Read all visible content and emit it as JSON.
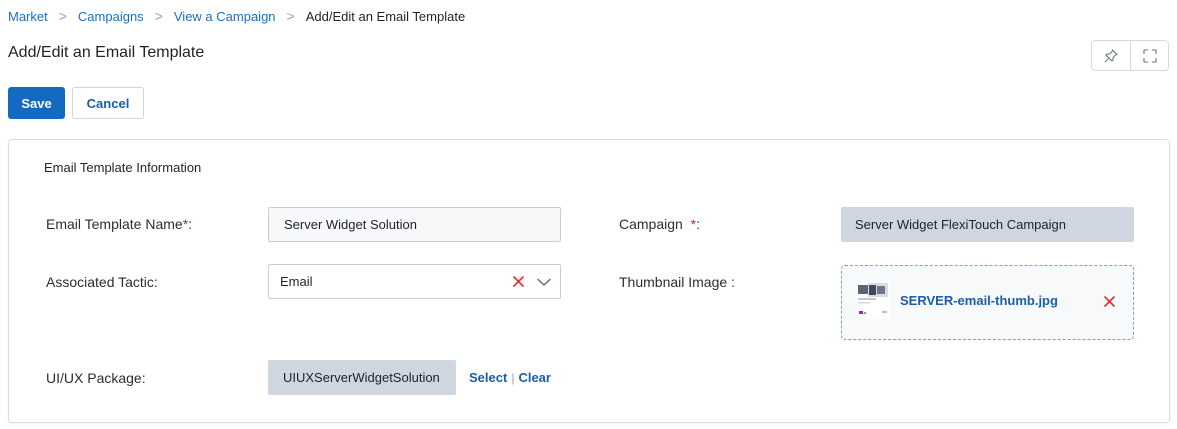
{
  "breadcrumb": {
    "items": [
      "Market",
      "Campaigns",
      "View a Campaign"
    ],
    "current": "Add/Edit an Email Template",
    "separator": ">"
  },
  "page": {
    "title": "Add/Edit an Email Template"
  },
  "toolbar": {
    "pin_icon": "pin-icon",
    "fullscreen_icon": "expand-icon"
  },
  "actions": {
    "save_label": "Save",
    "cancel_label": "Cancel"
  },
  "form": {
    "section_title": "Email Template Information",
    "template_name": {
      "label": "Email Template Name",
      "required_mark": "*",
      "suffix": ":",
      "value": "Server Widget Solution"
    },
    "campaign": {
      "label": "Campaign",
      "required_mark": "*",
      "suffix": ":",
      "value": "Server Widget FlexiTouch Campaign"
    },
    "tactic": {
      "label": "Associated Tactic:",
      "value": "Email"
    },
    "thumbnail": {
      "label": "Thumbnail Image :",
      "file_name": "SERVER-email-thumb.jpg"
    },
    "package": {
      "label": "UI/UX Package:",
      "value": "UIUXServerWidgetSolution",
      "select_label": "Select",
      "divider": "|",
      "clear_label": "Clear"
    }
  },
  "colors": {
    "accent": "#1469c1",
    "link": "#1a5ea8",
    "required": "#c62828",
    "remove": "#e03131"
  }
}
